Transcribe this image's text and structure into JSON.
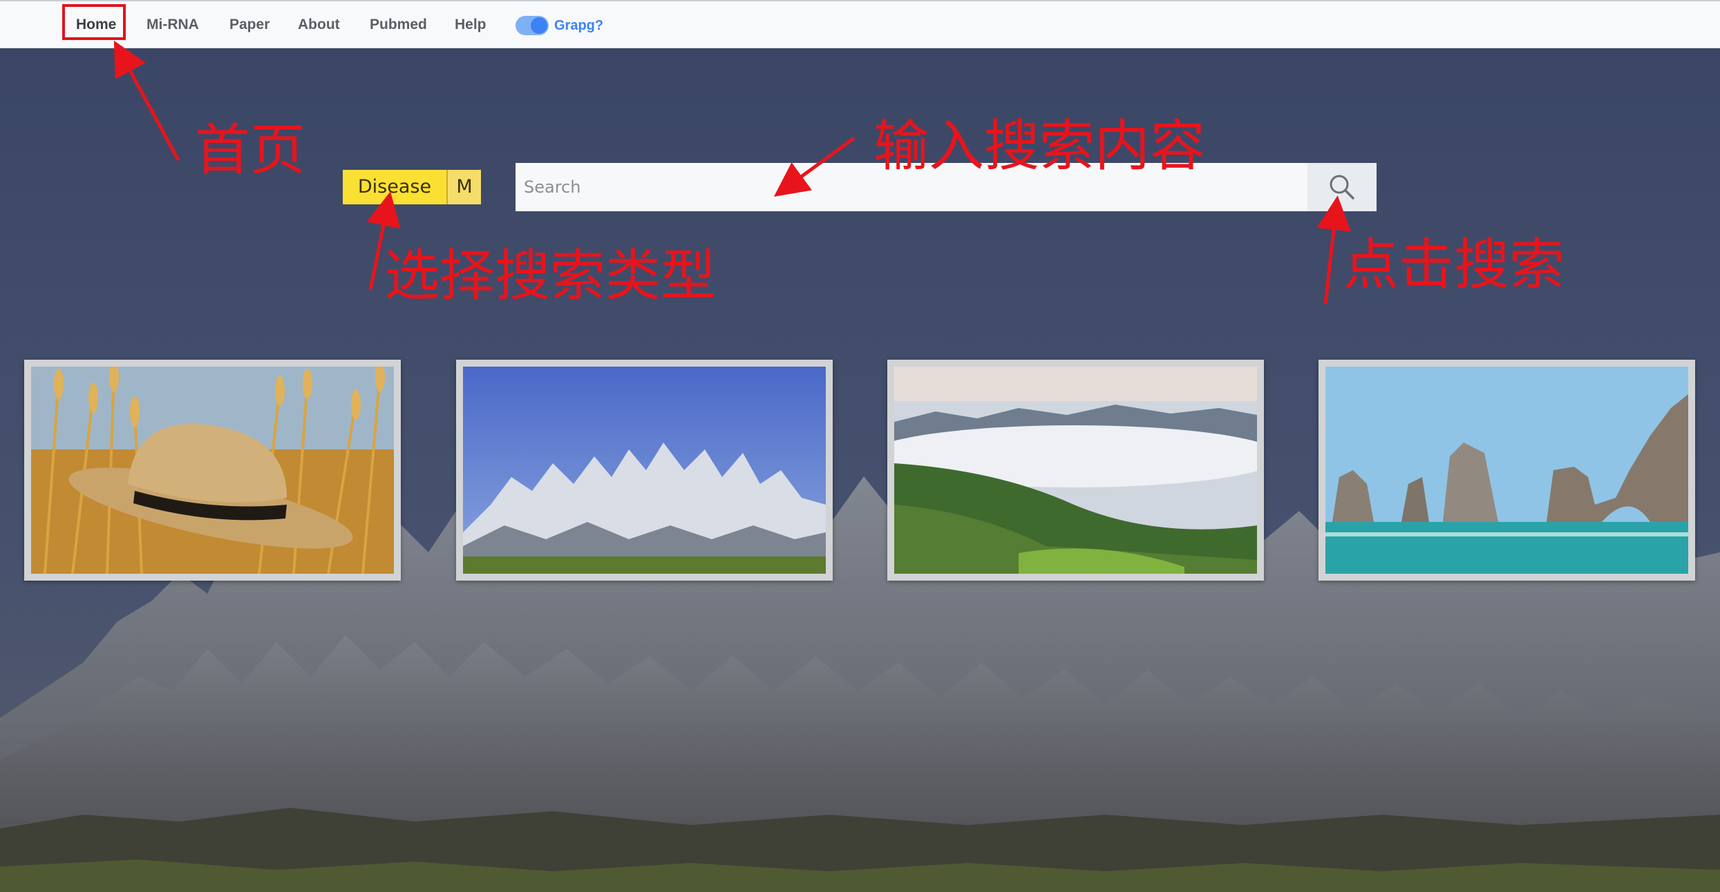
{
  "nav": {
    "items": [
      {
        "label": "Home"
      },
      {
        "label": "Mi-RNA"
      },
      {
        "label": "Paper"
      },
      {
        "label": "About"
      },
      {
        "label": "Pubmed"
      },
      {
        "label": "Help"
      }
    ],
    "toggle_label": "Grapg?",
    "toggle_on": true
  },
  "search": {
    "types": [
      {
        "label": "Disease",
        "selected": true
      },
      {
        "label": "M",
        "selected": false
      }
    ],
    "placeholder": "Search",
    "value": ""
  },
  "gallery": [
    {
      "subject": "straw hat in wheat field"
    },
    {
      "subject": "snowy mountain peaks under blue sky"
    },
    {
      "subject": "valley with sea of clouds"
    },
    {
      "subject": "sea rock arches"
    }
  ],
  "annotations": {
    "home": "首页",
    "input": "输入搜索内容",
    "type": "选择搜索类型",
    "click": "点击搜索"
  },
  "colors": {
    "accent": "#3b82f6",
    "type_button": "#fbe034",
    "annotation": "#e8141c",
    "background_sky": "#3e4a6a"
  },
  "icons": [
    "search-icon",
    "toggle-switch"
  ]
}
